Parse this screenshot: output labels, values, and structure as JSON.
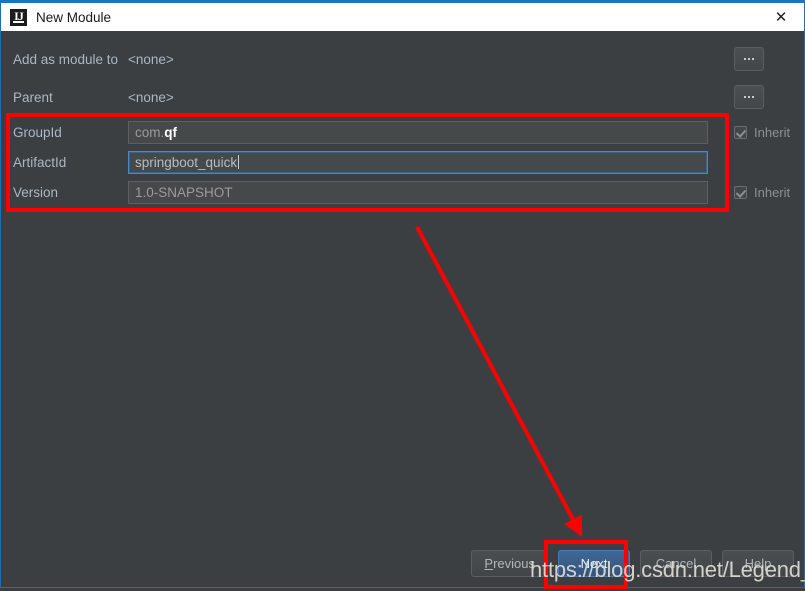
{
  "window": {
    "title": "New Module",
    "icon": "intellij-idea-logo-icon",
    "close_label": "✕"
  },
  "form": {
    "rows": [
      {
        "label": "Add as module to",
        "value": "<none>",
        "type": "static",
        "button": "..."
      },
      {
        "label": "Parent",
        "value": "<none>",
        "type": "static",
        "button": "..."
      }
    ],
    "coordinates": [
      {
        "label": "GroupId",
        "value_prefix": "com. ",
        "value_highlight": "qf",
        "value": "com. qf",
        "focused": false,
        "inherit_label": "Inherit",
        "inherit_checked": true
      },
      {
        "label": "ArtifactId",
        "value": "springboot_quick",
        "focused": true,
        "inherit_label": "",
        "inherit_checked": false
      },
      {
        "label": "Version",
        "value": "1.0-SNAPSHOT",
        "focused": false,
        "inherit_label": "Inherit",
        "inherit_checked": true
      }
    ]
  },
  "footer": {
    "previous": {
      "mnemonic": "P",
      "rest": "revious"
    },
    "next": "Next",
    "cancel": "Cancel",
    "help": "Help"
  },
  "annotations": {
    "watermark": "https://blog.csdn.net/Legend_Young",
    "accent_color": "#fe0000"
  }
}
